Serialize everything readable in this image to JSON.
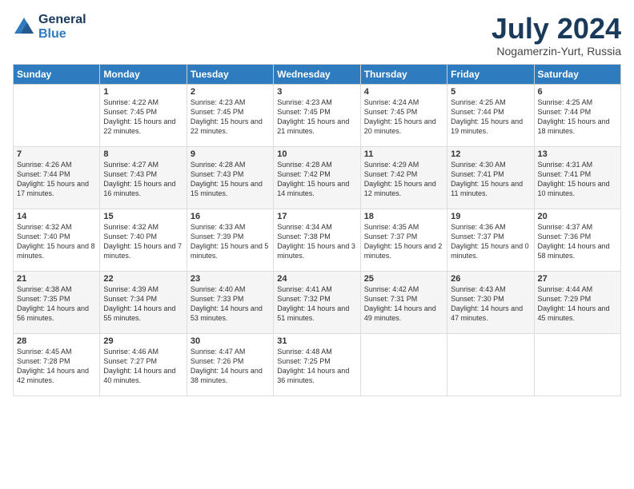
{
  "header": {
    "logo": {
      "general": "General",
      "blue": "Blue"
    },
    "title": "July 2024",
    "location": "Nogamerzin-Yurt, Russia"
  },
  "calendar": {
    "days_of_week": [
      "Sunday",
      "Monday",
      "Tuesday",
      "Wednesday",
      "Thursday",
      "Friday",
      "Saturday"
    ],
    "weeks": [
      [
        {
          "day": "",
          "sunrise": "",
          "sunset": "",
          "daylight": ""
        },
        {
          "day": "1",
          "sunrise": "Sunrise: 4:22 AM",
          "sunset": "Sunset: 7:45 PM",
          "daylight": "Daylight: 15 hours and 22 minutes."
        },
        {
          "day": "2",
          "sunrise": "Sunrise: 4:23 AM",
          "sunset": "Sunset: 7:45 PM",
          "daylight": "Daylight: 15 hours and 22 minutes."
        },
        {
          "day": "3",
          "sunrise": "Sunrise: 4:23 AM",
          "sunset": "Sunset: 7:45 PM",
          "daylight": "Daylight: 15 hours and 21 minutes."
        },
        {
          "day": "4",
          "sunrise": "Sunrise: 4:24 AM",
          "sunset": "Sunset: 7:45 PM",
          "daylight": "Daylight: 15 hours and 20 minutes."
        },
        {
          "day": "5",
          "sunrise": "Sunrise: 4:25 AM",
          "sunset": "Sunset: 7:44 PM",
          "daylight": "Daylight: 15 hours and 19 minutes."
        },
        {
          "day": "6",
          "sunrise": "Sunrise: 4:25 AM",
          "sunset": "Sunset: 7:44 PM",
          "daylight": "Daylight: 15 hours and 18 minutes."
        }
      ],
      [
        {
          "day": "7",
          "sunrise": "Sunrise: 4:26 AM",
          "sunset": "Sunset: 7:44 PM",
          "daylight": "Daylight: 15 hours and 17 minutes."
        },
        {
          "day": "8",
          "sunrise": "Sunrise: 4:27 AM",
          "sunset": "Sunset: 7:43 PM",
          "daylight": "Daylight: 15 hours and 16 minutes."
        },
        {
          "day": "9",
          "sunrise": "Sunrise: 4:28 AM",
          "sunset": "Sunset: 7:43 PM",
          "daylight": "Daylight: 15 hours and 15 minutes."
        },
        {
          "day": "10",
          "sunrise": "Sunrise: 4:28 AM",
          "sunset": "Sunset: 7:42 PM",
          "daylight": "Daylight: 15 hours and 14 minutes."
        },
        {
          "day": "11",
          "sunrise": "Sunrise: 4:29 AM",
          "sunset": "Sunset: 7:42 PM",
          "daylight": "Daylight: 15 hours and 12 minutes."
        },
        {
          "day": "12",
          "sunrise": "Sunrise: 4:30 AM",
          "sunset": "Sunset: 7:41 PM",
          "daylight": "Daylight: 15 hours and 11 minutes."
        },
        {
          "day": "13",
          "sunrise": "Sunrise: 4:31 AM",
          "sunset": "Sunset: 7:41 PM",
          "daylight": "Daylight: 15 hours and 10 minutes."
        }
      ],
      [
        {
          "day": "14",
          "sunrise": "Sunrise: 4:32 AM",
          "sunset": "Sunset: 7:40 PM",
          "daylight": "Daylight: 15 hours and 8 minutes."
        },
        {
          "day": "15",
          "sunrise": "Sunrise: 4:32 AM",
          "sunset": "Sunset: 7:40 PM",
          "daylight": "Daylight: 15 hours and 7 minutes."
        },
        {
          "day": "16",
          "sunrise": "Sunrise: 4:33 AM",
          "sunset": "Sunset: 7:39 PM",
          "daylight": "Daylight: 15 hours and 5 minutes."
        },
        {
          "day": "17",
          "sunrise": "Sunrise: 4:34 AM",
          "sunset": "Sunset: 7:38 PM",
          "daylight": "Daylight: 15 hours and 3 minutes."
        },
        {
          "day": "18",
          "sunrise": "Sunrise: 4:35 AM",
          "sunset": "Sunset: 7:37 PM",
          "daylight": "Daylight: 15 hours and 2 minutes."
        },
        {
          "day": "19",
          "sunrise": "Sunrise: 4:36 AM",
          "sunset": "Sunset: 7:37 PM",
          "daylight": "Daylight: 15 hours and 0 minutes."
        },
        {
          "day": "20",
          "sunrise": "Sunrise: 4:37 AM",
          "sunset": "Sunset: 7:36 PM",
          "daylight": "Daylight: 14 hours and 58 minutes."
        }
      ],
      [
        {
          "day": "21",
          "sunrise": "Sunrise: 4:38 AM",
          "sunset": "Sunset: 7:35 PM",
          "daylight": "Daylight: 14 hours and 56 minutes."
        },
        {
          "day": "22",
          "sunrise": "Sunrise: 4:39 AM",
          "sunset": "Sunset: 7:34 PM",
          "daylight": "Daylight: 14 hours and 55 minutes."
        },
        {
          "day": "23",
          "sunrise": "Sunrise: 4:40 AM",
          "sunset": "Sunset: 7:33 PM",
          "daylight": "Daylight: 14 hours and 53 minutes."
        },
        {
          "day": "24",
          "sunrise": "Sunrise: 4:41 AM",
          "sunset": "Sunset: 7:32 PM",
          "daylight": "Daylight: 14 hours and 51 minutes."
        },
        {
          "day": "25",
          "sunrise": "Sunrise: 4:42 AM",
          "sunset": "Sunset: 7:31 PM",
          "daylight": "Daylight: 14 hours and 49 minutes."
        },
        {
          "day": "26",
          "sunrise": "Sunrise: 4:43 AM",
          "sunset": "Sunset: 7:30 PM",
          "daylight": "Daylight: 14 hours and 47 minutes."
        },
        {
          "day": "27",
          "sunrise": "Sunrise: 4:44 AM",
          "sunset": "Sunset: 7:29 PM",
          "daylight": "Daylight: 14 hours and 45 minutes."
        }
      ],
      [
        {
          "day": "28",
          "sunrise": "Sunrise: 4:45 AM",
          "sunset": "Sunset: 7:28 PM",
          "daylight": "Daylight: 14 hours and 42 minutes."
        },
        {
          "day": "29",
          "sunrise": "Sunrise: 4:46 AM",
          "sunset": "Sunset: 7:27 PM",
          "daylight": "Daylight: 14 hours and 40 minutes."
        },
        {
          "day": "30",
          "sunrise": "Sunrise: 4:47 AM",
          "sunset": "Sunset: 7:26 PM",
          "daylight": "Daylight: 14 hours and 38 minutes."
        },
        {
          "day": "31",
          "sunrise": "Sunrise: 4:48 AM",
          "sunset": "Sunset: 7:25 PM",
          "daylight": "Daylight: 14 hours and 36 minutes."
        },
        {
          "day": "",
          "sunrise": "",
          "sunset": "",
          "daylight": ""
        },
        {
          "day": "",
          "sunrise": "",
          "sunset": "",
          "daylight": ""
        },
        {
          "day": "",
          "sunrise": "",
          "sunset": "",
          "daylight": ""
        }
      ]
    ]
  }
}
